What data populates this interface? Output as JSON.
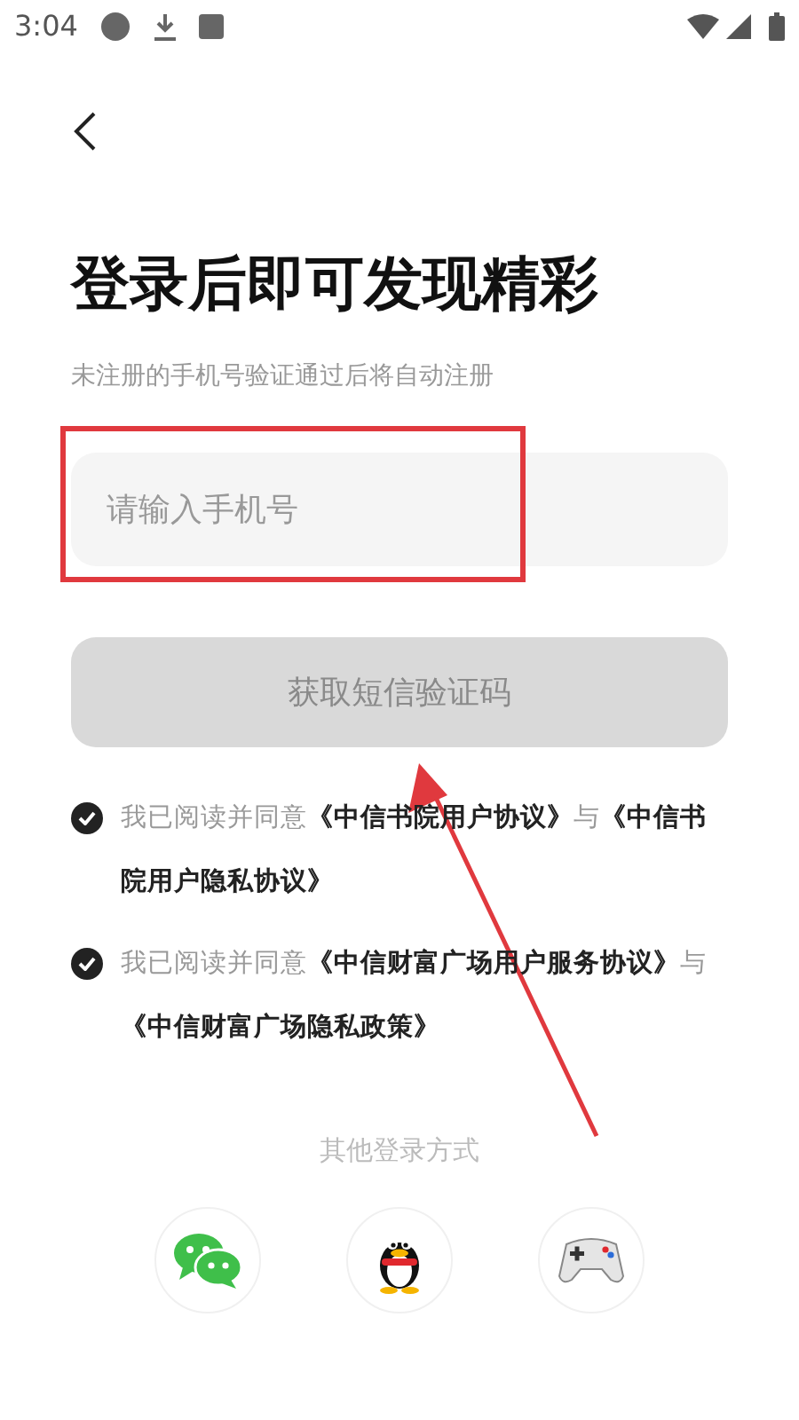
{
  "status_bar": {
    "time": "3:04"
  },
  "title": "登录后即可发现精彩",
  "subtitle": "未注册的手机号验证通过后将自动注册",
  "phone_field": {
    "placeholder": "请输入手机号"
  },
  "code_button": {
    "label": "获取短信验证码",
    "disabled": true
  },
  "agreements": [
    {
      "text": "我已阅读并同意**《中信书院用户协议》**与**《中信书院用户隐私协议》**",
      "checked": true
    },
    {
      "text": "我已阅读并同意**《中信财富广场用户服务协议》**与**《中信财富广场隐私政策》**",
      "checked": true
    }
  ],
  "other_login": {
    "label": "其他登录方式",
    "methods": [
      {
        "kind": "wechat"
      },
      {
        "kind": "qq"
      },
      {
        "kind": "game"
      }
    ]
  }
}
